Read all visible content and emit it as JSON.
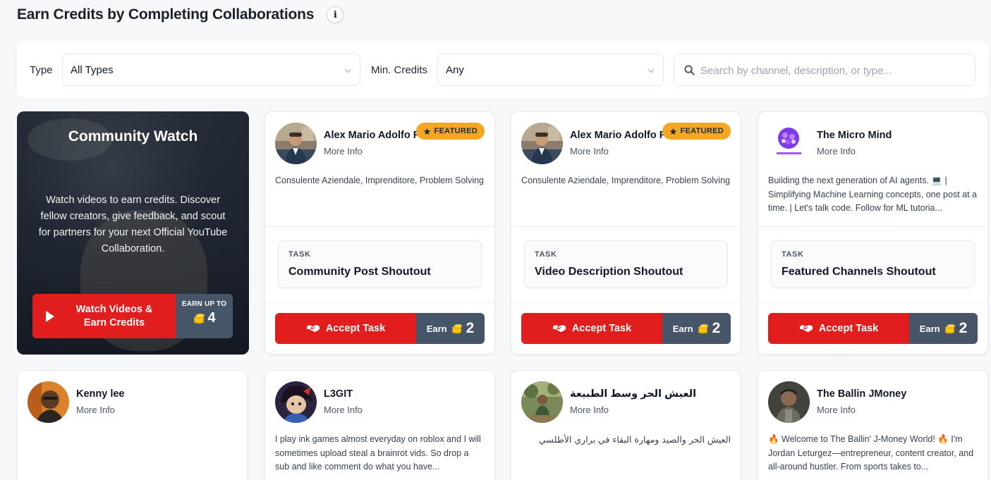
{
  "page": {
    "title": "Earn Credits by Completing Collaborations"
  },
  "filters": {
    "type_label": "Type",
    "type_value": "All Types",
    "min_credits_label": "Min. Credits",
    "min_credits_value": "Any",
    "search_placeholder": "Search by channel, description, or type..."
  },
  "promo": {
    "title": "Community Watch",
    "description": "Watch videos to earn credits. Discover fellow creators, give feedback, and scout for partners for your next Official YouTube Collaboration.",
    "button_label": "Watch Videos & Earn Credits",
    "earn_label": "EARN UP TO",
    "earn_value": "4"
  },
  "labels": {
    "more_info": "More Info",
    "featured": "FEATURED",
    "task": "TASK",
    "accept": "Accept Task",
    "earn": "Earn"
  },
  "cards": [
    {
      "name": "Alex Mario Adolfo F",
      "featured": true,
      "description": "Consulente Aziendale, Imprenditore, Problem Solving",
      "task": "Community Post Shoutout",
      "credits": "2"
    },
    {
      "name": "Alex Mario Adolfo F",
      "featured": true,
      "description": "Consulente Aziendale, Imprenditore, Problem Solving",
      "task": "Video Description Shoutout",
      "credits": "2"
    },
    {
      "name": "The Micro Mind",
      "featured": false,
      "description": "Building the next generation of AI agents. 💻 | Simplifying Machine Learning concepts, one post at a time. | Let's talk code. Follow for ML tutoria...",
      "task": "Featured Channels Shoutout",
      "credits": "2"
    },
    {
      "name": "Kenny lee",
      "description": ""
    },
    {
      "name": "L3GIT",
      "description": "I play ink games almost everyday on roblox and I will sometimes upload steal a brainrot vids. So drop a sub and like comment do what you have..."
    },
    {
      "name": "العيش الحر وسط الطبيعة",
      "description": "العيش الحر والصيد ومهارة البقاء في براري الأطلسي"
    },
    {
      "name": "The Ballin JMoney",
      "description": "🔥 Welcome to The Ballin' J-Money World! 🔥 I'm Jordan Leturgez—entrepreneur, content creator, and all-around hustler. From sports takes to..."
    }
  ],
  "colors": {
    "accent_red": "#e11d1d",
    "earn_slate": "#475569",
    "featured_gold": "#f5a623"
  }
}
